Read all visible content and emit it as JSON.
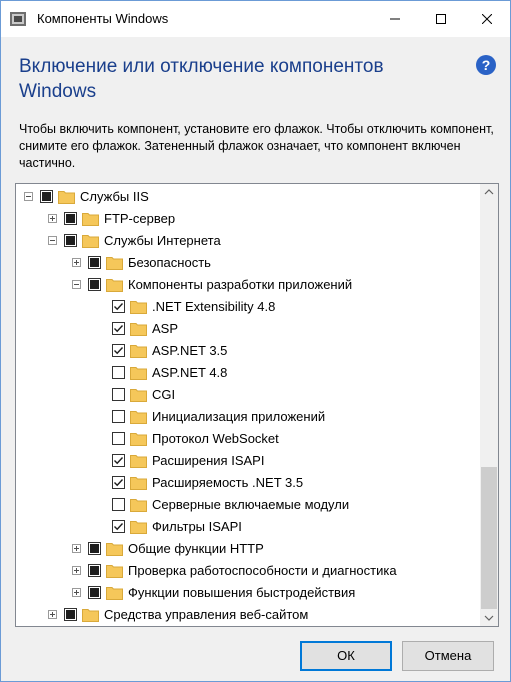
{
  "window": {
    "title": "Компоненты Windows",
    "heading": "Включение или отключение компонентов Windows",
    "description": "Чтобы включить компонент, установите его флажок. Чтобы отключить компонент, снимите его флажок. Затененный флажок означает, что компонент включен частично.",
    "help_icon": "question-mark-icon",
    "help_label": "?"
  },
  "tree": [
    {
      "label": "Службы IIS",
      "level": 0,
      "expander": "minus",
      "check": "partial"
    },
    {
      "label": "FTP-сервер",
      "level": 1,
      "expander": "plus",
      "check": "partial"
    },
    {
      "label": "Службы Интернета",
      "level": 1,
      "expander": "minus",
      "check": "partial"
    },
    {
      "label": "Безопасность",
      "level": 2,
      "expander": "plus",
      "check": "partial"
    },
    {
      "label": "Компоненты разработки приложений",
      "level": 2,
      "expander": "minus",
      "check": "partial"
    },
    {
      "label": ".NET Extensibility 4.8",
      "level": 3,
      "expander": "none",
      "check": "checked"
    },
    {
      "label": "ASP",
      "level": 3,
      "expander": "none",
      "check": "checked"
    },
    {
      "label": "ASP.NET 3.5",
      "level": 3,
      "expander": "none",
      "check": "checked"
    },
    {
      "label": "ASP.NET 4.8",
      "level": 3,
      "expander": "none",
      "check": "unchecked"
    },
    {
      "label": "CGI",
      "level": 3,
      "expander": "none",
      "check": "unchecked"
    },
    {
      "label": "Инициализация приложений",
      "level": 3,
      "expander": "none",
      "check": "unchecked"
    },
    {
      "label": "Протокол WebSocket",
      "level": 3,
      "expander": "none",
      "check": "unchecked"
    },
    {
      "label": "Расширения ISAPI",
      "level": 3,
      "expander": "none",
      "check": "checked"
    },
    {
      "label": "Расширяемость .NET 3.5",
      "level": 3,
      "expander": "none",
      "check": "checked"
    },
    {
      "label": "Серверные включаемые модули",
      "level": 3,
      "expander": "none",
      "check": "unchecked"
    },
    {
      "label": "Фильтры ISAPI",
      "level": 3,
      "expander": "none",
      "check": "checked"
    },
    {
      "label": "Общие функции HTTP",
      "level": 2,
      "expander": "plus",
      "check": "partial"
    },
    {
      "label": "Проверка работоспособности и диагностика",
      "level": 2,
      "expander": "plus",
      "check": "partial"
    },
    {
      "label": "Функции повышения быстродействия",
      "level": 2,
      "expander": "plus",
      "check": "partial"
    },
    {
      "label": "Средства управления веб-сайтом",
      "level": 1,
      "expander": "plus",
      "check": "partial"
    }
  ],
  "buttons": {
    "ok": "ОК",
    "cancel": "Отмена"
  },
  "colors": {
    "heading": "#1a3f8c",
    "accent": "#0078d7",
    "folder": "#f5c75a"
  }
}
